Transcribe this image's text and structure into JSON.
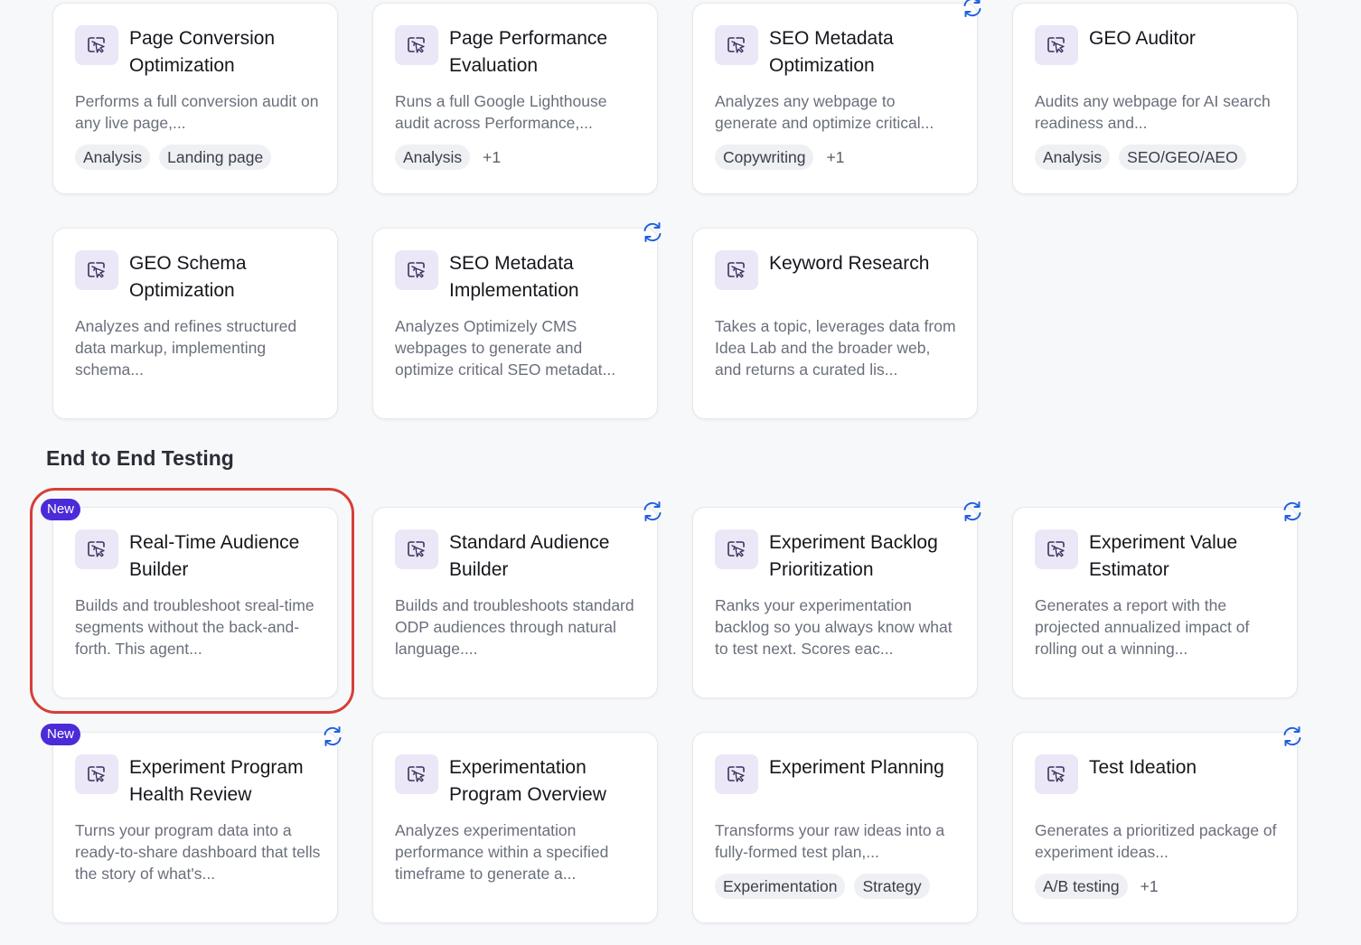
{
  "section": {
    "title": "End to End Testing"
  },
  "badge_new_label": "New",
  "accent_colors": {
    "badge": "#4b2bd8",
    "sync_icon": "#1f5fdf",
    "highlight": "#d63f3a",
    "icon_tile": "#ebe7f6"
  },
  "cards": [
    {
      "title": "Page Conversion Optimization",
      "description": "Performs a full conversion audit on any live page,...",
      "tags": [
        "Analysis",
        "Landing page"
      ],
      "more": "",
      "sync": false,
      "is_new": false
    },
    {
      "title": "Page Performance Evaluation",
      "description": "Runs a full Google Lighthouse audit across Performance,...",
      "tags": [
        "Analysis"
      ],
      "more": "+1",
      "sync": false,
      "is_new": false
    },
    {
      "title": "SEO Metadata Optimization",
      "description": "Analyzes any webpage to generate and optimize critical...",
      "tags": [
        "Copywriting"
      ],
      "more": "+1",
      "sync": true,
      "is_new": false
    },
    {
      "title": "GEO Auditor",
      "description": "Audits any webpage for AI search readiness and...",
      "tags": [
        "Analysis",
        "SEO/GEO/AEO"
      ],
      "more": "",
      "sync": false,
      "is_new": false
    },
    {
      "title": "GEO Schema Optimization",
      "description": "Analyzes and refines structured data markup, implementing schema...",
      "tags": [],
      "more": "",
      "sync": false,
      "is_new": false
    },
    {
      "title": "SEO Metadata Implementation",
      "description": "Analyzes Optimizely CMS webpages to generate and optimize critical SEO metadat...",
      "tags": [],
      "more": "",
      "sync": true,
      "is_new": false
    },
    {
      "title": "Keyword Research",
      "description": "Takes a topic, leverages data from Idea Lab and the broader web, and returns a curated lis...",
      "tags": [],
      "more": "",
      "sync": false,
      "is_new": false
    },
    {
      "title": "Real-Time Audience Builder",
      "description": "Builds and troubleshoot sreal-time segments without the back-and-forth. This agent...",
      "tags": [],
      "more": "",
      "sync": false,
      "is_new": true
    },
    {
      "title": "Standard Audience Builder",
      "description": "Builds and troubleshoots standard ODP audiences through natural language....",
      "tags": [],
      "more": "",
      "sync": true,
      "is_new": false
    },
    {
      "title": "Experiment Backlog Prioritization",
      "description": "Ranks your experimentation backlog so you always know what to test next. Scores eac...",
      "tags": [],
      "more": "",
      "sync": true,
      "is_new": false
    },
    {
      "title": "Experiment Value Estimator",
      "description": "Generates a report with the projected annualized impact of rolling out a winning...",
      "tags": [],
      "more": "",
      "sync": true,
      "is_new": false
    },
    {
      "title": "Experiment Program Health Review",
      "description": "Turns your program data into a ready-to-share dashboard that tells the story of what's...",
      "tags": [],
      "more": "",
      "sync": true,
      "is_new": true
    },
    {
      "title": "Experimentation Program Overview",
      "description": "Analyzes experimentation performance within a specified timeframe to generate a...",
      "tags": [],
      "more": "",
      "sync": false,
      "is_new": false
    },
    {
      "title": "Experiment Planning",
      "description": "Transforms your raw ideas into a fully-formed test plan,...",
      "tags": [
        "Experimentation",
        "Strategy"
      ],
      "more": "",
      "sync": false,
      "is_new": false
    },
    {
      "title": "Test Ideation",
      "description": "Generates a prioritized package of experiment ideas...",
      "tags": [
        "A/B testing"
      ],
      "more": "+1",
      "sync": true,
      "is_new": false
    }
  ]
}
